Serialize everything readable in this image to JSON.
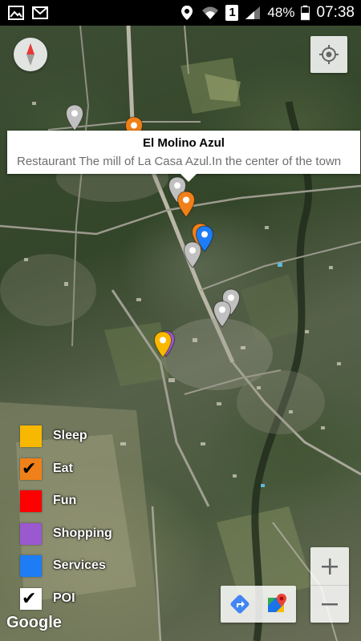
{
  "status_bar": {
    "battery_percent": "48%",
    "time": "07:38",
    "sim_slot": "1",
    "icons": [
      "image-icon",
      "gmail-icon",
      "location-icon",
      "wifi-icon",
      "sim-icon",
      "signal-icon",
      "battery-icon"
    ]
  },
  "info_window": {
    "title": "El Molino Azul",
    "snippet": "Restaurant The mill of La Casa Azul.In the center of the town"
  },
  "legend": {
    "items": [
      {
        "label": "Sleep",
        "color": "#f9b800",
        "checked": false
      },
      {
        "label": "Eat",
        "color": "#f08019",
        "checked": true
      },
      {
        "label": "Fun",
        "color": "#ff0000",
        "checked": false
      },
      {
        "label": "Shopping",
        "color": "#9b59d0",
        "checked": false
      },
      {
        "label": "Services",
        "color": "#1e7cf5",
        "checked": false
      },
      {
        "label": "POI",
        "color": "#ffffff",
        "checked": true
      }
    ]
  },
  "map": {
    "attribution": "Google",
    "controls": [
      "compass-icon",
      "my-location-icon",
      "zoom-in-icon",
      "zoom-out-icon",
      "directions-icon",
      "google-maps-icon"
    ],
    "markers": [
      {
        "category": "POI",
        "color": "#c0c0c0"
      },
      {
        "category": "Eat",
        "color": "#f08019"
      },
      {
        "category": "POI",
        "color": "#c0c0c0"
      },
      {
        "category": "Eat",
        "color": "#f08019"
      },
      {
        "category": "Eat",
        "color": "#f08019"
      },
      {
        "category": "Services",
        "color": "#1e7cf5"
      },
      {
        "category": "POI",
        "color": "#c0c0c0"
      },
      {
        "category": "POI",
        "color": "#c0c0c0"
      },
      {
        "category": "POI",
        "color": "#c0c0c0"
      },
      {
        "category": "Shopping",
        "color": "#9b59d0"
      },
      {
        "category": "Sleep",
        "color": "#f9b800"
      }
    ]
  }
}
